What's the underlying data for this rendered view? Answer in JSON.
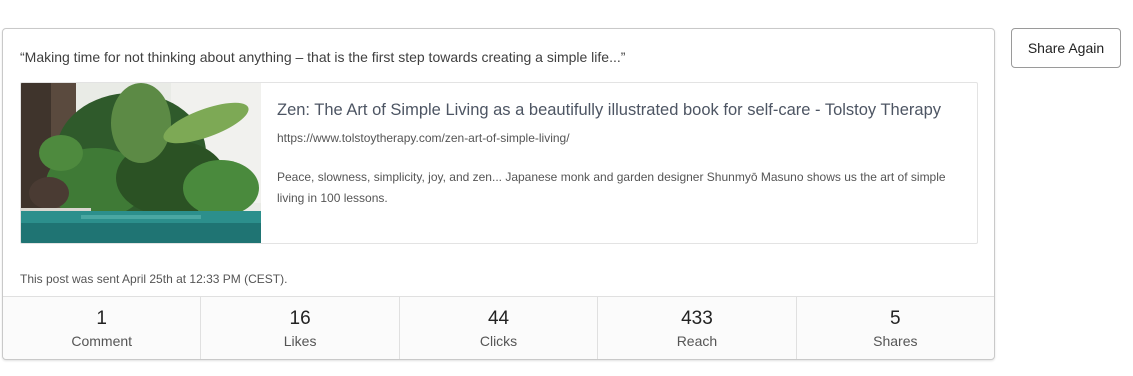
{
  "post": {
    "text": "“Making time for not thinking about anything – that is the first step towards creating a simple life...”",
    "link_preview": {
      "title": "Zen: The Art of Simple Living as a beautifully illustrated book for self-care - Tolstoy Therapy",
      "url": "https://www.tolstoytherapy.com/zen-art-of-simple-living/",
      "description": "Peace, slowness, simplicity, joy, and zen... Japanese monk and garden designer Shunmyō Masuno shows us the art of simple living in 100 lessons.",
      "image": "garden-pool-photo"
    },
    "sent_info": "This post was sent April 25th at 12:33 PM (CEST).",
    "stats": [
      {
        "value": "1",
        "label": "Comment"
      },
      {
        "value": "16",
        "label": "Likes"
      },
      {
        "value": "44",
        "label": "Clicks"
      },
      {
        "value": "433",
        "label": "Reach"
      },
      {
        "value": "5",
        "label": "Shares"
      }
    ]
  },
  "actions": {
    "share_again_label": "Share Again"
  }
}
